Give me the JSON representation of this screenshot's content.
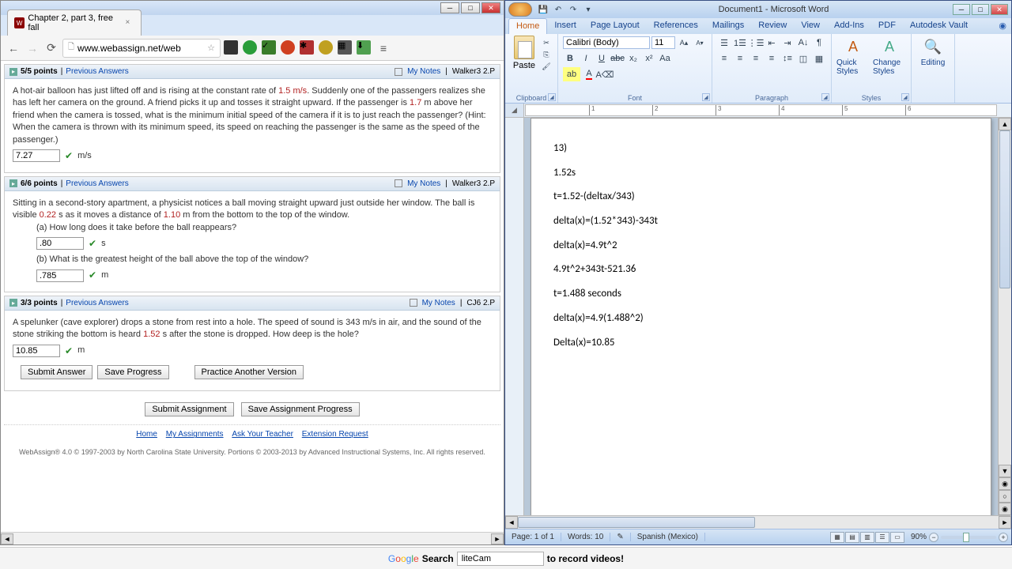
{
  "chrome": {
    "tab_title": "Chapter 2, part 3, free fall",
    "url": "www.webassign.net/web",
    "questions": [
      {
        "points": "5/5 points",
        "prev": "Previous Answers",
        "notes": "My Notes",
        "ref": "Walker3 2.P",
        "text_a": "A hot-air balloon has just lifted off and is rising at the constant rate of ",
        "v1": "1.5 m/s",
        "text_b": ". Suddenly one of the passengers realizes she has left her camera on the ground. A friend picks it up and tosses it straight upward. If the passenger is ",
        "v2": "1.7",
        "text_c": " m above her friend when the camera is tossed, what is the minimum initial speed of the camera if it is to just reach the passenger? (Hint: When the camera is thrown with its minimum speed, its speed on reaching the passenger is the same as the speed of the passenger.)",
        "answer": "7.27",
        "unit": "m/s"
      },
      {
        "points": "6/6 points",
        "prev": "Previous Answers",
        "notes": "My Notes",
        "ref": "Walker3 2.P",
        "text_a": "Sitting in a second-story apartment, a physicist notices a ball moving straight upward just outside her window. The ball is visible ",
        "v1": "0.22",
        "text_b": " s as it moves a distance of ",
        "v2": "1.10",
        "text_c": " m from the bottom to the top of the window.",
        "sub_a": "(a) How long does it take before the ball reappears?",
        "ans_a": ".80",
        "unit_a": "s",
        "sub_b": "(b) What is the greatest height of the ball above the top of the window?",
        "ans_b": ".785",
        "unit_b": "m"
      },
      {
        "points": "3/3 points",
        "prev": "Previous Answers",
        "notes": "My Notes",
        "ref": "CJ6 2.P",
        "text_a": "A spelunker (cave explorer) drops a stone from rest into a hole. The speed of sound is 343 m/s in air, and the sound of the stone striking the bottom is heard ",
        "v1": "1.52",
        "text_b": " s after the stone is dropped. How deep is the hole?",
        "answer": "10.85",
        "unit": "m",
        "btn_submit": "Submit Answer",
        "btn_save": "Save Progress",
        "btn_practice": "Practice Another Version"
      }
    ],
    "submit_assignment": "Submit Assignment",
    "save_assignment": "Save Assignment Progress",
    "footer_links": [
      "Home",
      "My Assignments",
      "Ask Your Teacher",
      "Extension Request"
    ],
    "copyright": "WebAssign® 4.0 © 1997-2003 by North Carolina State University. Portions © 2003-2013 by Advanced Instructional Systems, Inc. All rights reserved."
  },
  "word": {
    "title": "Document1 - Microsoft Word",
    "tabs": [
      "Home",
      "Insert",
      "Page Layout",
      "References",
      "Mailings",
      "Review",
      "View",
      "Add-Ins",
      "PDF",
      "Autodesk Vault"
    ],
    "font_name": "Calibri (Body)",
    "font_size": "11",
    "groups": {
      "clipboard": "Clipboard",
      "font": "Font",
      "paragraph": "Paragraph",
      "styles": "Styles",
      "editing": "Editing"
    },
    "paste": "Paste",
    "quick_styles": "Quick Styles",
    "change_styles": "Change Styles",
    "editing_btn": "Editing",
    "doc_lines": [
      "13)",
      "1.52s",
      "t=1.52-(deltax/343)",
      "delta(x)=(1.52*343)-343t",
      "delta(x)=4.9t^2",
      "4.9t^2+343t-521.36",
      "t=1.488 seconds",
      "delta(x)=4.9(1.488^2)",
      "Delta(x)=10.85"
    ],
    "status": {
      "page": "Page: 1 of 1",
      "words": "Words: 10",
      "lang": "Spanish (Mexico)",
      "zoom": "90%"
    }
  },
  "bottom": {
    "search_label": "Search",
    "search_value": "liteCam",
    "tagline": "to record videos!"
  }
}
